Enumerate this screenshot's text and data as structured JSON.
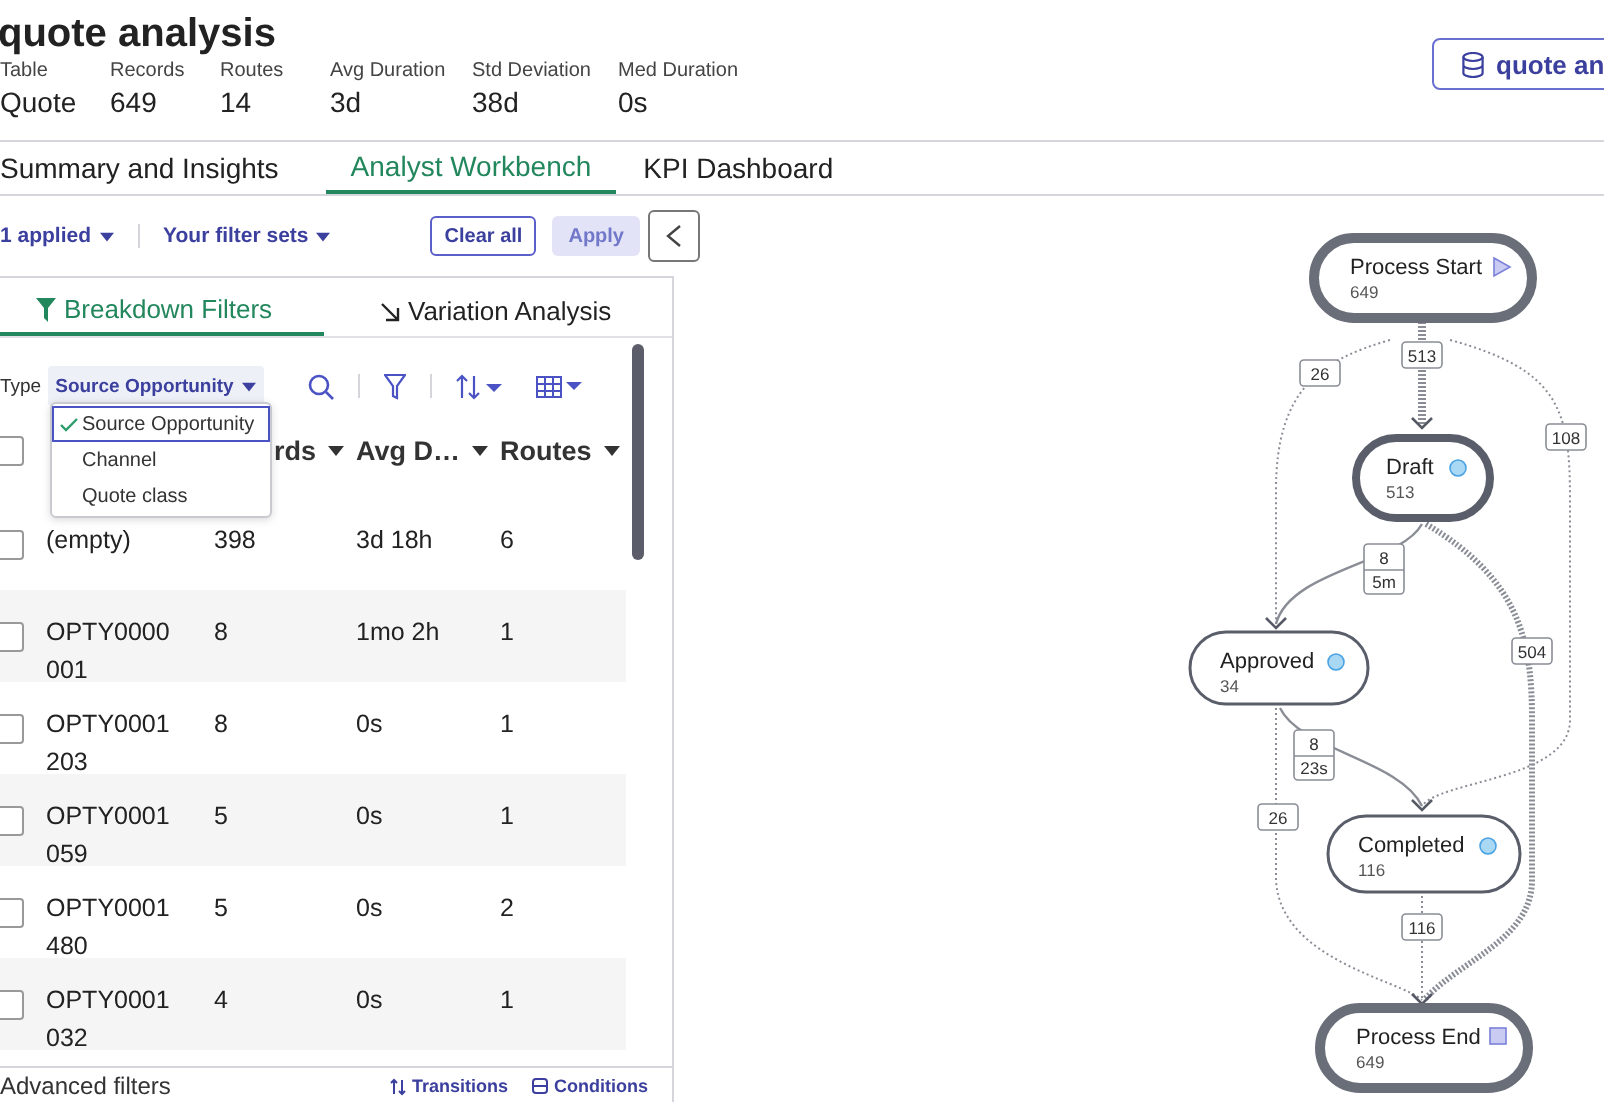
{
  "header": {
    "title": "quote analysis",
    "source_button": "quote an",
    "stats": [
      {
        "label": "Table",
        "value": "Quote"
      },
      {
        "label": "Records",
        "value": "649"
      },
      {
        "label": "Routes",
        "value": "14"
      },
      {
        "label": "Avg Duration",
        "value": "3d"
      },
      {
        "label": "Std Deviation",
        "value": "38d"
      },
      {
        "label": "Med Duration",
        "value": "0s"
      }
    ]
  },
  "tabs": [
    {
      "label": "Summary and Insights",
      "selected": false
    },
    {
      "label": "Analyst Workbench",
      "selected": true
    },
    {
      "label": "KPI Dashboard",
      "selected": false
    }
  ],
  "toolbar": {
    "applied": "1 applied",
    "filter_sets": "Your filter sets",
    "clear": {
      "label": "Clear all"
    },
    "apply": {
      "label": "Apply",
      "disabled": true
    }
  },
  "panel": {
    "tabs": [
      {
        "label": "Breakdown Filters",
        "selected": true
      },
      {
        "label": "Variation Analysis",
        "selected": false
      }
    ],
    "type_label": "Type",
    "type_select": {
      "value": "Source Opportunity",
      "expanded": true,
      "options": [
        {
          "label": "Source Opportunity",
          "selected": true
        },
        {
          "label": "Channel",
          "selected": false
        },
        {
          "label": "Quote class",
          "selected": false
        }
      ]
    },
    "columns": [
      "rds",
      "Avg D…",
      "Routes"
    ],
    "header_checked": false,
    "rows": [
      {
        "name": "(empty)",
        "records": "398",
        "avg": "3d 18h",
        "routes": "6",
        "checked": false
      },
      {
        "name": "OPTY0000001",
        "records": "8",
        "avg": "1mo 2h",
        "routes": "1",
        "checked": false
      },
      {
        "name": "OPTY0001203",
        "records": "8",
        "avg": "0s",
        "routes": "1",
        "checked": false
      },
      {
        "name": "OPTY0001059",
        "records": "5",
        "avg": "0s",
        "routes": "1",
        "checked": false
      },
      {
        "name": "OPTY0001480",
        "records": "5",
        "avg": "0s",
        "routes": "2",
        "checked": false
      },
      {
        "name": "OPTY0001032",
        "records": "4",
        "avg": "0s",
        "routes": "1",
        "checked": false
      }
    ],
    "footer": {
      "title": "Advanced filters",
      "links": [
        "Transitions",
        "Conditions"
      ]
    }
  },
  "graph": {
    "nodes": [
      {
        "kind": "start",
        "name": "Process Start",
        "count": "649"
      },
      {
        "kind": "activity",
        "name": "Draft",
        "count": "513"
      },
      {
        "kind": "activity",
        "name": "Approved",
        "count": "34"
      },
      {
        "kind": "activity",
        "name": "Completed",
        "count": "116"
      },
      {
        "kind": "end",
        "name": "Process End",
        "count": "649"
      }
    ],
    "edges": [
      {
        "label": "513"
      },
      {
        "label": "26"
      },
      {
        "label": "108"
      },
      {
        "label": "8",
        "duration": "5m"
      },
      {
        "label": "504"
      },
      {
        "label": "8",
        "duration": "23s"
      },
      {
        "label": "26"
      },
      {
        "label": "116"
      }
    ]
  }
}
